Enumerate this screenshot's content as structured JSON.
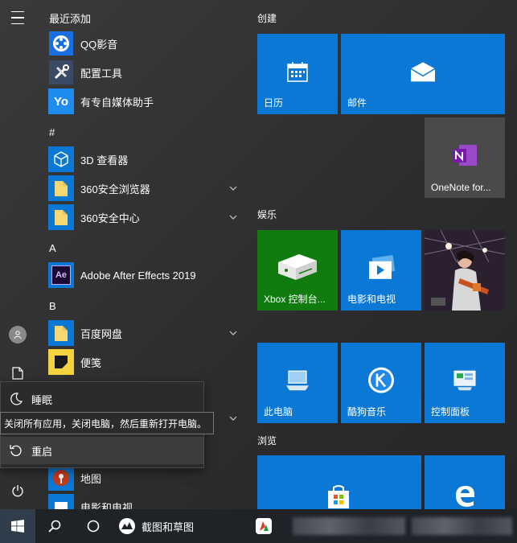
{
  "rail": {
    "items": [
      {
        "icon": "hamburger-menu-icon"
      },
      {
        "icon": "user-avatar-icon"
      },
      {
        "icon": "documents-icon"
      },
      {
        "icon": "power-icon"
      }
    ]
  },
  "applist": {
    "sections": [
      {
        "header": "最近添加"
      },
      {
        "header": "#"
      },
      {
        "header": "A"
      },
      {
        "header": "B"
      }
    ],
    "apps": [
      {
        "label": "QQ影音"
      },
      {
        "label": "配置工具"
      },
      {
        "label": "有专自媒体助手"
      },
      {
        "label": "3D 查看器"
      },
      {
        "label": "360安全浏览器"
      },
      {
        "label": "360安全中心"
      },
      {
        "label": "Adobe After Effects 2019"
      },
      {
        "label": "百度网盘"
      },
      {
        "label": "便笺"
      },
      {
        "label": "地图"
      },
      {
        "label": "电影和电视"
      }
    ],
    "ae_icon_text": "Ae",
    "qq_icon_text": "Yo"
  },
  "power_menu": {
    "sleep": "睡眠",
    "restart": "重启",
    "tooltip": "关闭所有应用，关闭电脑，然后重新打开电脑。"
  },
  "tiles": {
    "groups": [
      {
        "title": "创建"
      },
      {
        "title": "娱乐"
      },
      {
        "title": "浏览"
      }
    ],
    "items": [
      {
        "label": "日历"
      },
      {
        "label": "邮件"
      },
      {
        "label": "OneNote for..."
      },
      {
        "label": "Xbox 控制台..."
      },
      {
        "label": "电影和电视"
      },
      {
        "label": "此电脑"
      },
      {
        "label": "酷狗音乐"
      },
      {
        "label": "控制面板"
      }
    ],
    "colors": {
      "blue": "#0a78d4",
      "xbox": "#107c10",
      "gray": "#4a4a4a"
    }
  },
  "taskbar": {
    "snip_label": "截图和草图"
  }
}
